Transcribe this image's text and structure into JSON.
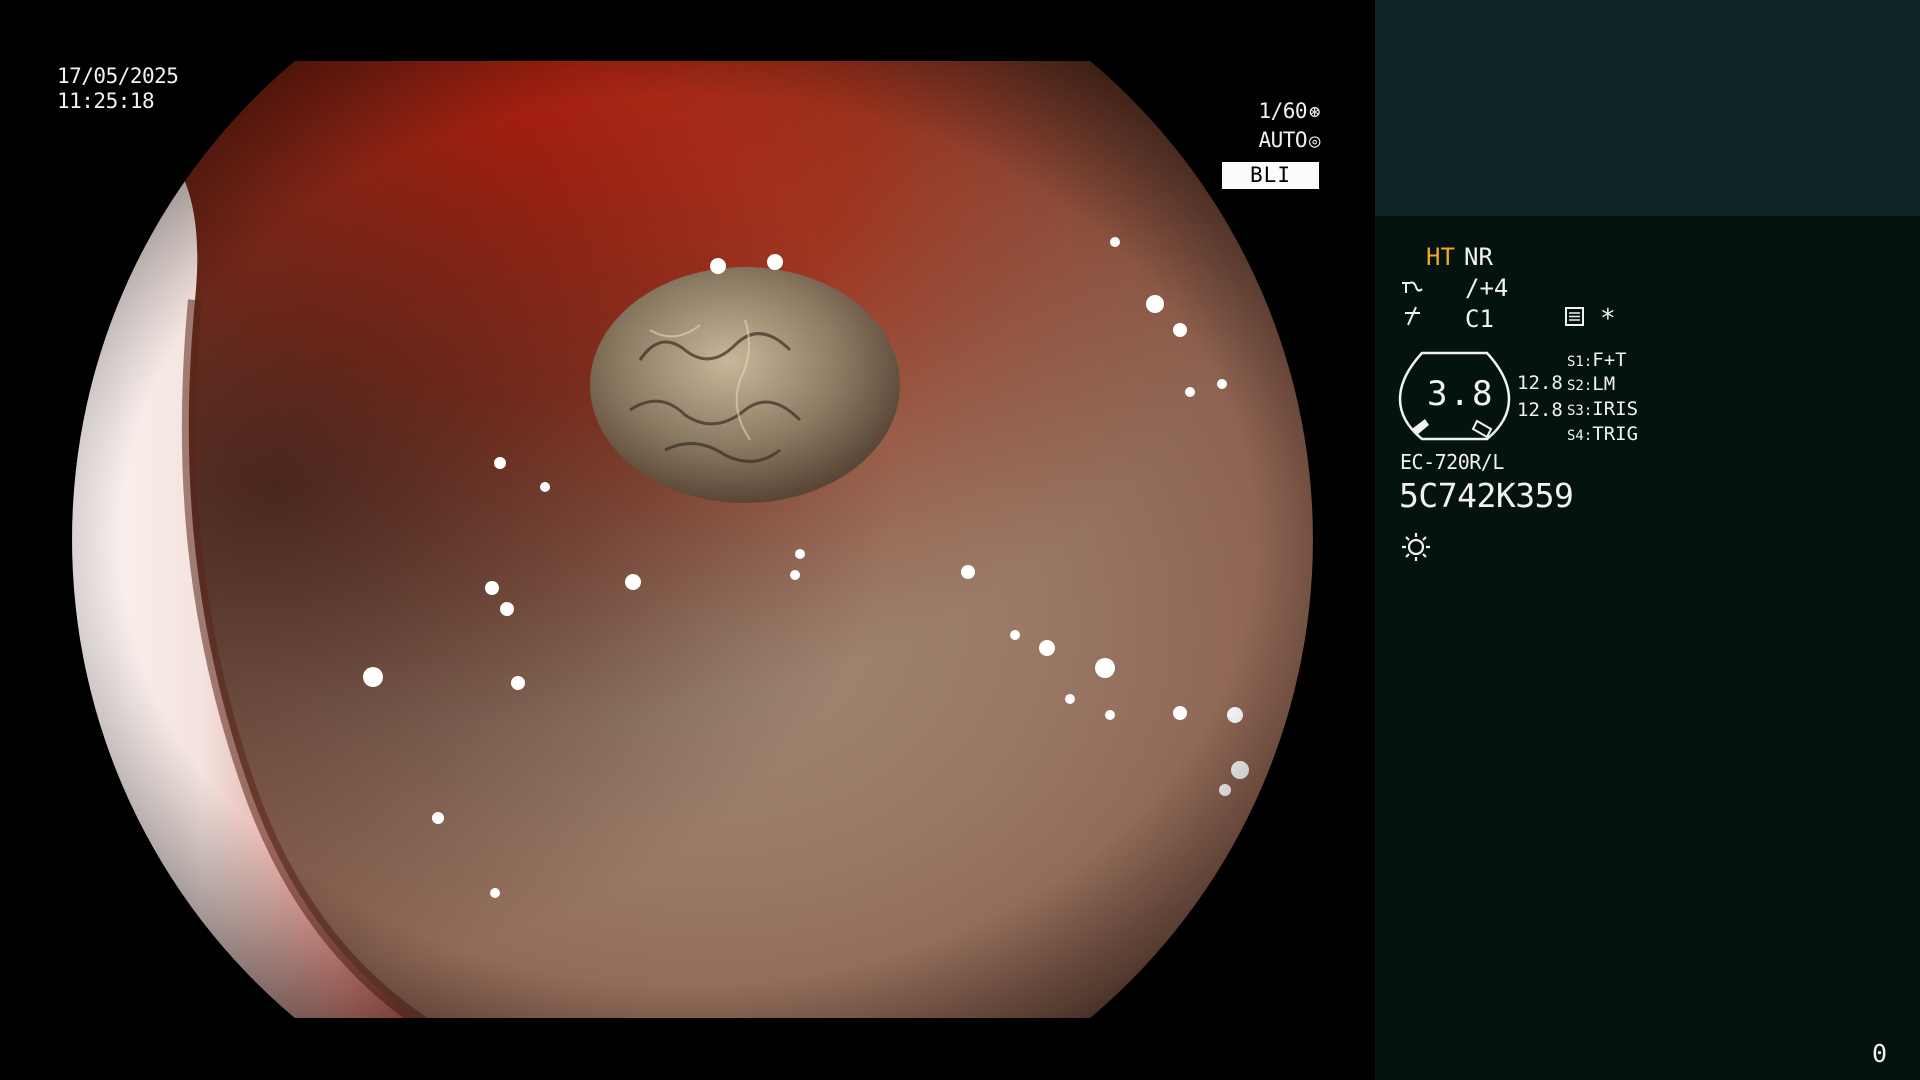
{
  "overlay": {
    "date": "17/05/2025",
    "time": "11:25:18",
    "shutter": "1/60",
    "shutter_icon": "aperture-icon",
    "exposure": "AUTO",
    "exposure_icon": "iris-icon",
    "mode": "BLI"
  },
  "panel": {
    "ht": "HT",
    "nr": "NR",
    "enhancement_icon": "structure-enhancement-icon",
    "enhancement": "/+4",
    "color_icon": "color-enhancement-icon",
    "color": "C1",
    "menu_icon": "menu-icon",
    "asterisk": "*",
    "gauge_value": "3.8",
    "gauge_right_1": "12.8",
    "gauge_right_2": "12.8",
    "switches": [
      {
        "key": "S1",
        "value": "F+T"
      },
      {
        "key": "S2",
        "value": "LM"
      },
      {
        "key": "S3",
        "value": "IRIS"
      },
      {
        "key": "S4",
        "value": "TRIG"
      }
    ],
    "scope_model": "EC-720R/L",
    "serial": "5C742K359",
    "light_icon": "light-source-icon",
    "counter": "0"
  },
  "colors": {
    "ht_accent": "#f0a623",
    "panel_top": "#0e2426",
    "panel_bottom": "#051310",
    "mode_badge": "#fbfbfb"
  }
}
